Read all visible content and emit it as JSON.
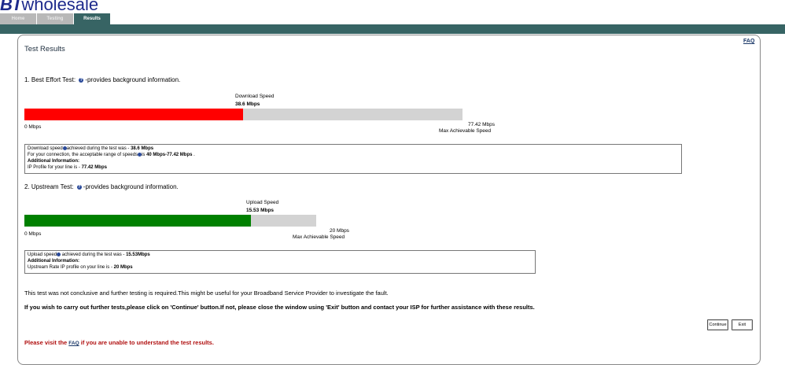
{
  "brand": {
    "bt": "BT",
    "rest": "wholesale"
  },
  "tabs": [
    {
      "label": "Home"
    },
    {
      "label": "Testing"
    },
    {
      "label": "Results"
    }
  ],
  "panel": {
    "faq_label": "FAQ",
    "title": "Test Results"
  },
  "best_effort": {
    "label_prefix": "1. Best Effort Test:",
    "label_suffix": "-provides background information.",
    "bar_title": "Download Speed",
    "bar_value": "38.6 Mbps",
    "value": 38.6,
    "max": 77.42,
    "min_label": "0 Mbps",
    "max_value_label": "77.42 Mbps",
    "max_label": "Max Achievable Speed",
    "color": "#ff0000",
    "info": {
      "line1_a": "Download speed",
      "line1_b": "achieved during the test was - ",
      "line1_value": "38.6 Mbps",
      "line2_a": "For your connection, the acceptable range of speeds",
      "line2_b": "is ",
      "line2_value": "40 Mbps-77.42 Mbps",
      "line2_c": " .",
      "line3": "Additional Information:",
      "line4_a": "IP Profile for your line is - ",
      "line4_value": "77.42 Mbps"
    }
  },
  "upstream": {
    "label_prefix": "2. Upstream Test:",
    "label_suffix": "-provides background information.",
    "bar_title": "Upload Speed",
    "bar_value": "15.53 Mbps",
    "value": 15.53,
    "max": 20,
    "min_label": "0 Mbps",
    "max_value_label": "20 Mbps",
    "max_label": "Max Achievable Speed",
    "color": "#008000",
    "info": {
      "line1_a": "Upload speed",
      "line1_b": " achieved during the test was - ",
      "line1_value": "15.53Mbps",
      "line2": "Additional Information:",
      "line3_a": "Upstream Rate IP profile on your line is - ",
      "line3_value": "20 Mbps"
    }
  },
  "messages": {
    "inconclusive": "This test was not conclusive and further testing is required.This might be useful for your Broadband Service Provider to investigate the fault.",
    "instructions": "If you wish to carry out further tests,please click on 'Continue' button.If not, please close the window using 'Exit' button and contact your ISP for further assistance with these results."
  },
  "buttons": {
    "continue": "Continue",
    "exit": "Exit"
  },
  "footer": {
    "visit_a": "Please visit the ",
    "faq_link": "FAQ",
    "visit_b": " if you are unable to understand the test results."
  }
}
